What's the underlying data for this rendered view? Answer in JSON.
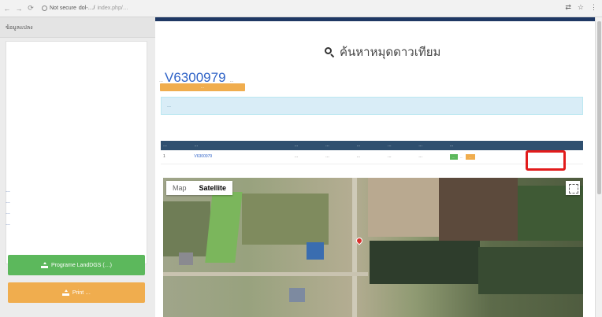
{
  "browser": {
    "nav_icons": [
      "back-icon",
      "forward-icon",
      "reload-icon"
    ],
    "url_status": "Not secure",
    "url_host": "dol-…/",
    "url_path": "index.php/…",
    "toolbar_icons": [
      "translate-icon",
      "bookmark-star-icon",
      "menu-icon"
    ]
  },
  "sidebar": {
    "header": "ข้อมูลแปลง",
    "info_lines": [
      "…",
      "…",
      "…",
      "…"
    ],
    "buttons": {
      "programe": "Programe LandDGS (…)",
      "print": "Print …"
    }
  },
  "main": {
    "title": "ค้นหาหมุดดาวเทียม",
    "code_prefix": "…",
    "code": "V6300979",
    "code_note": "…",
    "small_button": "…",
    "alert": "…"
  },
  "table": {
    "headers": [
      "…",
      "…",
      "…",
      "…",
      "…",
      "…",
      "…",
      "…"
    ],
    "rows": [
      {
        "cells": [
          "1",
          "V6300979",
          "…",
          "…",
          "…",
          "…",
          "…"
        ],
        "actions": {
          "view": "…",
          "text": "…",
          "print": "…"
        }
      }
    ]
  },
  "map": {
    "tabs": [
      "Map",
      "Satellite"
    ],
    "active_tab": "Satellite"
  },
  "colors": {
    "header_bar": "#1f3864",
    "code_blue": "#2f63c7",
    "green_button": "#5cb85c",
    "orange_button": "#f0ad4e",
    "highlight_box": "#e21b1b"
  }
}
